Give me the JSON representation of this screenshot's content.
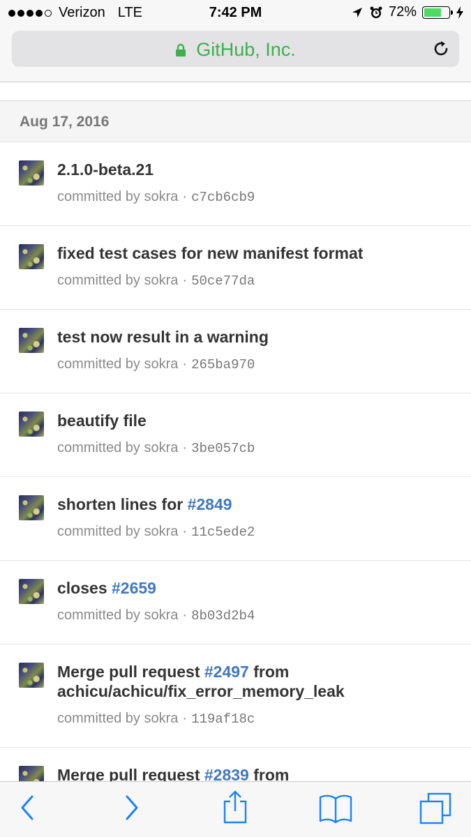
{
  "status_bar": {
    "carrier": "Verizon",
    "network": "LTE",
    "time": "7:42 PM",
    "battery_percent": "72%",
    "battery_level": 0.72,
    "signal_bars": 4
  },
  "address_bar": {
    "site_name": "GitHub, Inc.",
    "secure": true
  },
  "date_header": "Aug 17, 2016",
  "commits": [
    {
      "parts": [
        {
          "text": "2.1.0-beta.21"
        }
      ],
      "committed_by": "committed by sokra",
      "separator": "·",
      "sha": "c7cb6cb9"
    },
    {
      "parts": [
        {
          "text": "fixed test cases for new manifest format"
        }
      ],
      "committed_by": "committed by sokra",
      "separator": "·",
      "sha": "50ce77da"
    },
    {
      "parts": [
        {
          "text": "test now result in a warning"
        }
      ],
      "committed_by": "committed by sokra",
      "separator": "·",
      "sha": "265ba970"
    },
    {
      "parts": [
        {
          "text": "beautify file"
        }
      ],
      "committed_by": "committed by sokra",
      "separator": "·",
      "sha": "3be057cb"
    },
    {
      "parts": [
        {
          "text": "shorten lines for "
        },
        {
          "text": "#2849",
          "issue": true
        }
      ],
      "committed_by": "committed by sokra",
      "separator": "·",
      "sha": "11c5ede2"
    },
    {
      "parts": [
        {
          "text": "closes "
        },
        {
          "text": "#2659",
          "issue": true
        }
      ],
      "committed_by": "committed by sokra",
      "separator": "·",
      "sha": "8b03d2b4"
    },
    {
      "parts": [
        {
          "text": "Merge pull request "
        },
        {
          "text": "#2497",
          "issue": true
        },
        {
          "text": " from achicu/achicu/fix_error_memory_leak"
        }
      ],
      "committed_by": "committed by sokra",
      "separator": "·",
      "sha": "119af18c",
      "tall": true
    },
    {
      "parts": [
        {
          "text": "Merge pull request "
        },
        {
          "text": "#2839",
          "issue": true
        },
        {
          "text": " from"
        }
      ],
      "committed_by": "",
      "separator": "",
      "sha": ""
    }
  ],
  "toolbar": {
    "icons": [
      "back-icon",
      "forward-icon",
      "share-icon",
      "bookmarks-icon",
      "tabs-icon"
    ]
  },
  "colors": {
    "link": "#4078c0",
    "secure_green": "#3cb04c",
    "battery_green": "#4cd964",
    "ios_blue": "#1a82fb"
  }
}
